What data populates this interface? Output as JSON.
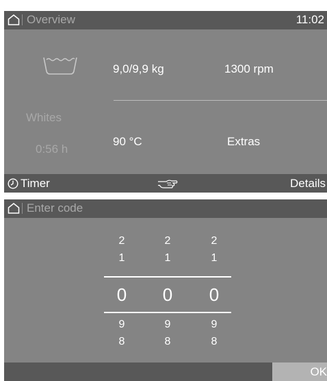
{
  "overview": {
    "title": "Overview",
    "time": "11:02",
    "program": "Whites",
    "duration": "0:56 h",
    "load": "9,0/9,9 kg",
    "spin": "1300 rpm",
    "temperature": "90 °C",
    "extras": "Extras",
    "footer": {
      "timer": "Timer",
      "details": "Details"
    }
  },
  "code_entry": {
    "title": "Enter code",
    "columns": [
      {
        "above2": "2",
        "above1": "1",
        "value": "0",
        "below1": "9",
        "below2": "8"
      },
      {
        "above2": "2",
        "above1": "1",
        "value": "0",
        "below1": "9",
        "below2": "8"
      },
      {
        "above2": "2",
        "above1": "1",
        "value": "0",
        "below1": "9",
        "below2": "8"
      }
    ],
    "ok": "OK"
  },
  "icons": [
    "home-icon",
    "basin-icon",
    "timer-icon",
    "hand-icon"
  ]
}
